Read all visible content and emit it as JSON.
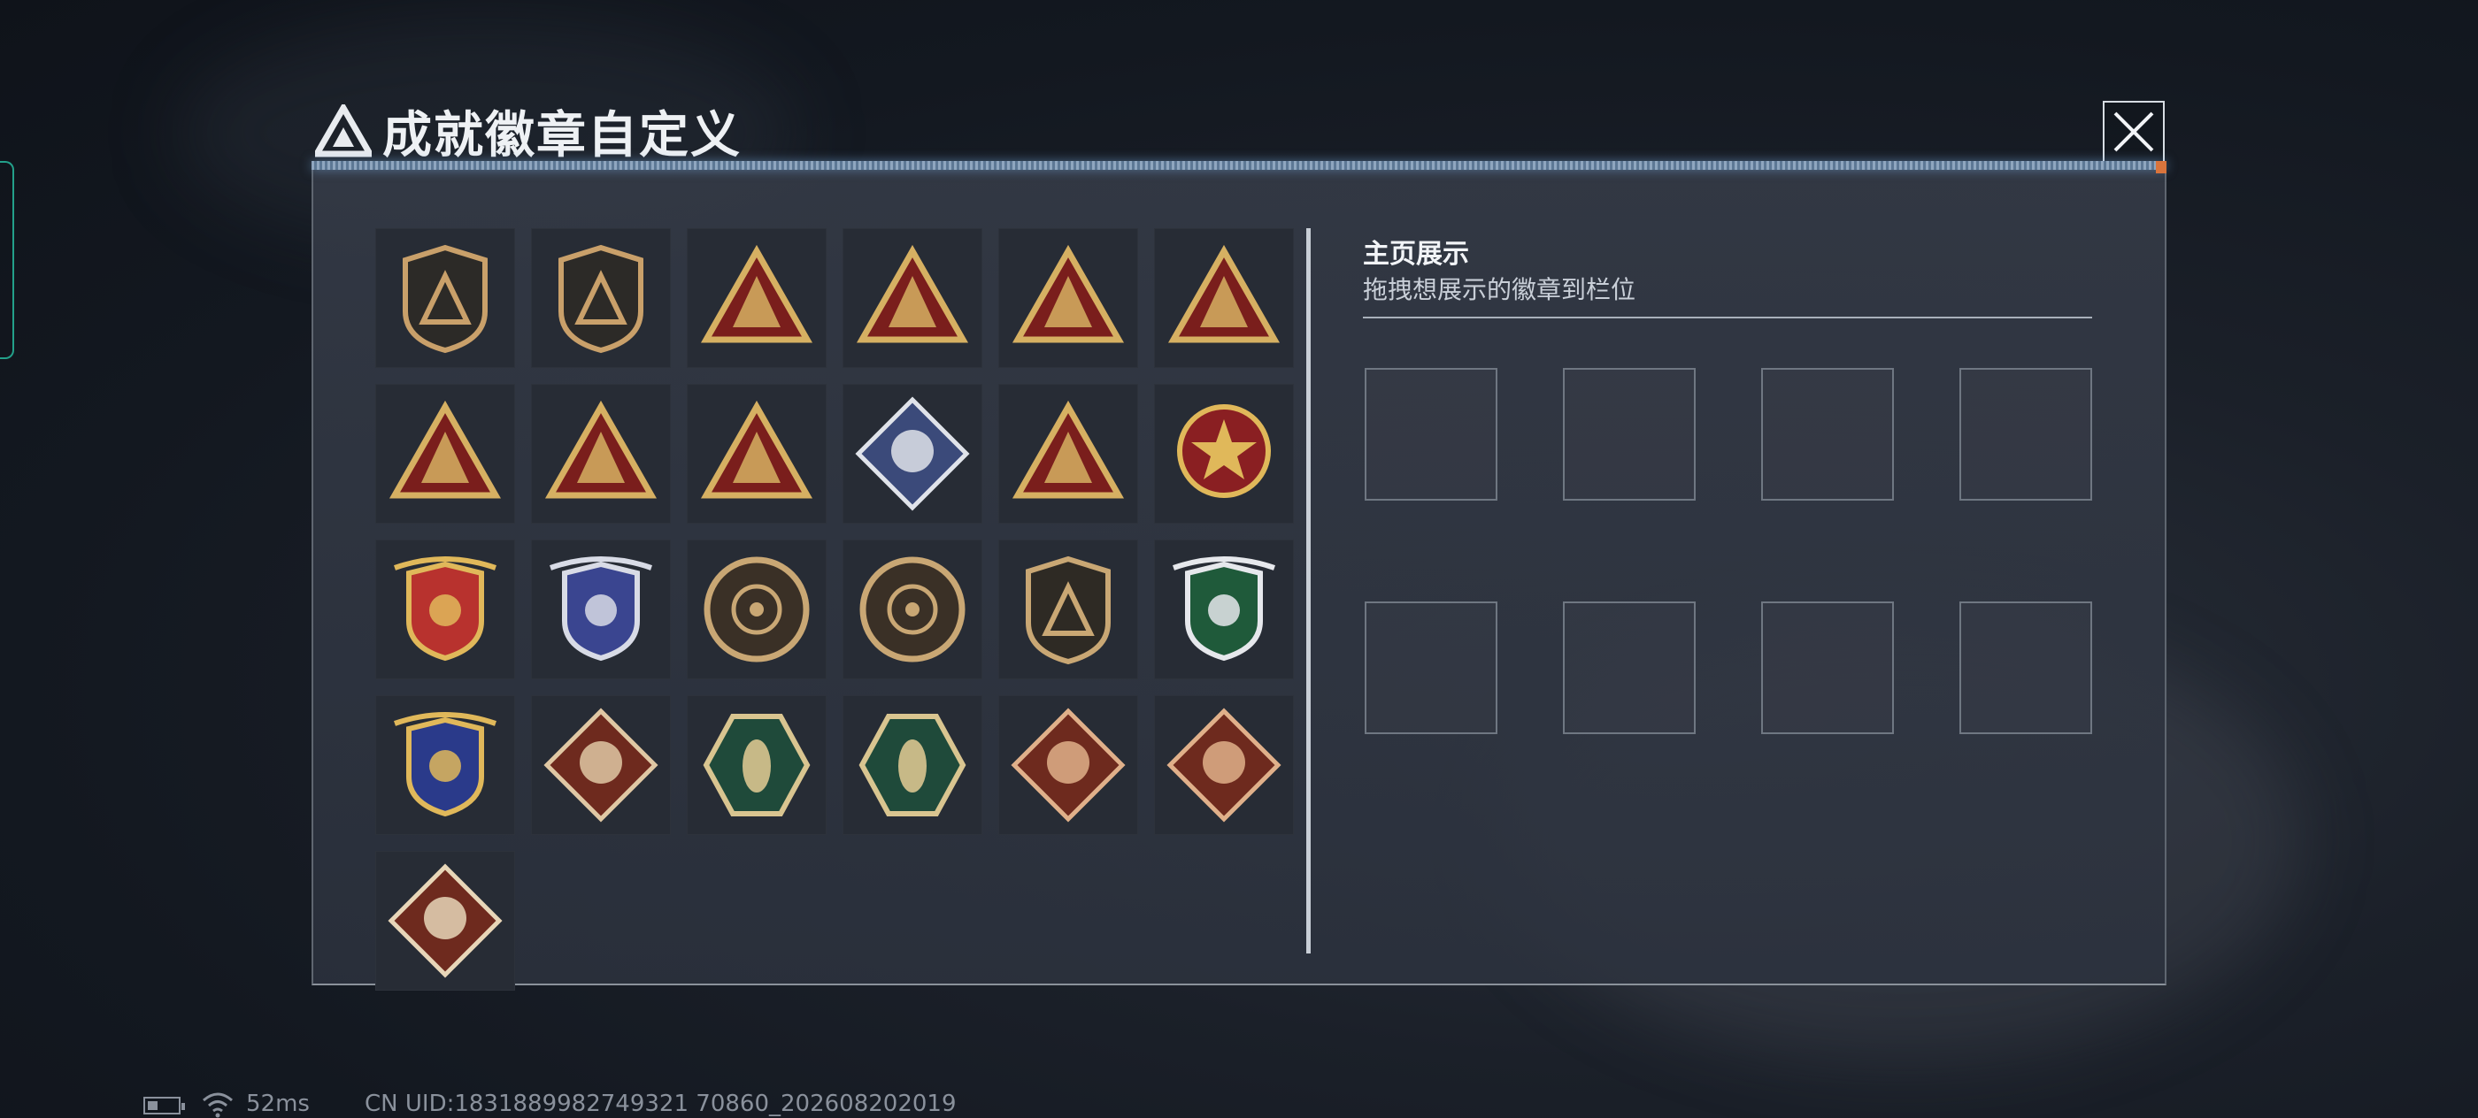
{
  "header": {
    "title": "成就徽章自定义",
    "close_icon": "close-x-icon"
  },
  "badge_grid": {
    "badges": [
      {
        "name": "emblem-shield-triangle-icon",
        "shape": "shield",
        "color": "#2c2a27",
        "accent": "#c9a06a"
      },
      {
        "name": "helicopter-shield-icon",
        "shape": "shield",
        "color": "#2c2a27",
        "accent": "#c9a06a"
      },
      {
        "name": "money-bag-triangle-icon",
        "shape": "triangle",
        "color": "#7a1e1c",
        "accent": "#d6b062"
      },
      {
        "name": "golden-egg-triangle-icon",
        "shape": "triangle",
        "color": "#7a1e1c",
        "accent": "#d6b062"
      },
      {
        "name": "number-one-triangle-icon",
        "shape": "triangle",
        "color": "#7a1e1c",
        "accent": "#d6b062"
      },
      {
        "name": "usb-drive-triangle-icon",
        "shape": "triangle",
        "color": "#7a1e1c",
        "accent": "#d6b062"
      },
      {
        "name": "soldier-rescue-triangle-icon",
        "shape": "triangle",
        "color": "#7a1e1c",
        "accent": "#d6b062"
      },
      {
        "name": "hands-gem-triangle-icon",
        "shape": "triangle",
        "color": "#7a1e1c",
        "accent": "#d6b062"
      },
      {
        "name": "squad-triangle-icon",
        "shape": "triangle",
        "color": "#7a1e1c",
        "accent": "#d6b062"
      },
      {
        "name": "rose-diamond-icon",
        "shape": "diamond",
        "color": "#3b4a7a",
        "accent": "#e0e3ea"
      },
      {
        "name": "diver-triangle-icon",
        "shape": "triangle",
        "color": "#7a1e1c",
        "accent": "#d6b062"
      },
      {
        "name": "star-medal-icon",
        "shape": "circle",
        "color": "#8a1f22",
        "accent": "#e0b85a"
      },
      {
        "name": "gold-shield-stars-icon",
        "shape": "crest",
        "color": "#b8322e",
        "accent": "#e0b85a"
      },
      {
        "name": "silver-gem-crest-icon",
        "shape": "crest",
        "color": "#3a4590",
        "accent": "#d8dbe6"
      },
      {
        "name": "crosshair-skull-coin-icon",
        "shape": "coin",
        "color": "#3a3026",
        "accent": "#c9a774"
      },
      {
        "name": "gas-mask-coin-icon",
        "shape": "coin",
        "color": "#3a3026",
        "accent": "#c9a774"
      },
      {
        "name": "rifle-shield-icon",
        "shape": "shield",
        "color": "#2e2a24",
        "accent": "#c9a774"
      },
      {
        "name": "sniper-scope-crest-icon",
        "shape": "crest",
        "color": "#1f5a3a",
        "accent": "#e6e8ec"
      },
      {
        "name": "crossed-arms-crest-icon",
        "shape": "crest",
        "color": "#2a3a8a",
        "accent": "#e0b85a"
      },
      {
        "name": "wolf-diamond-icon",
        "shape": "diamond",
        "color": "#6e2a1e",
        "accent": "#e0c8a4"
      },
      {
        "name": "wasp-hexagon-icon",
        "shape": "hexagon",
        "color": "#1f4a3a",
        "accent": "#d9c590"
      },
      {
        "name": "wasp-hexagon-alt-icon",
        "shape": "hexagon",
        "color": "#1f4a3a",
        "accent": "#d9c590"
      },
      {
        "name": "dragon-diamond-icon",
        "shape": "diamond",
        "color": "#6e2a1e",
        "accent": "#e0b08a"
      },
      {
        "name": "dragon-diamond-alt-icon",
        "shape": "diamond",
        "color": "#6e2a1e",
        "accent": "#e0b08a"
      },
      {
        "name": "runner-diamond-icon",
        "shape": "diamond",
        "color": "#6e2a1e",
        "accent": "#e8d6b8"
      }
    ]
  },
  "home_display": {
    "title": "主页展示",
    "subtitle": "拖拽想展示的徽章到栏位",
    "slot_count": 8
  },
  "status_bar": {
    "battery_level": 0.35,
    "wifi_icon": "wifi-icon",
    "battery_icon": "battery-icon",
    "ping": "52ms",
    "uid": "CN UID:1831889982749321 70860_202608202019"
  },
  "colors": {
    "panel_topline": "#8fa6bf",
    "accent_orange": "#d9743c",
    "left_tab": "#23a08a"
  }
}
